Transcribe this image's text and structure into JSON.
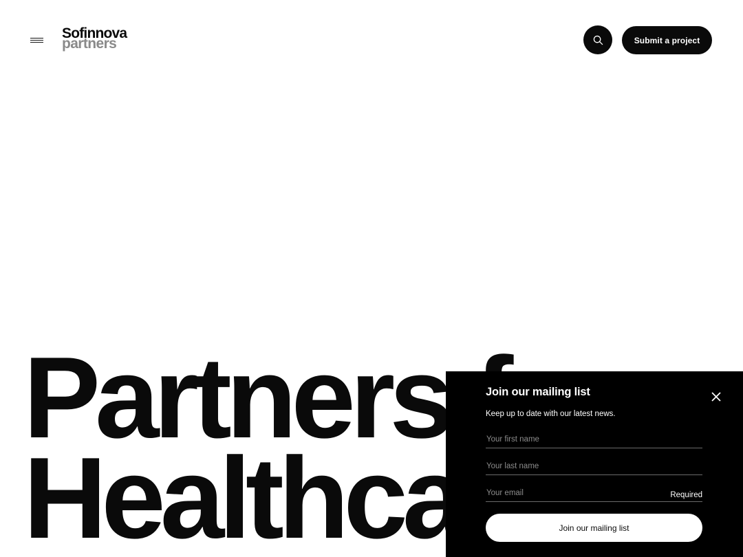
{
  "header": {
    "logo_top": "Sofinnova",
    "logo_bottom": "partners",
    "submit_label": "Submit a project"
  },
  "hero": {
    "line1": "Partners f",
    "line2": "Healthcare"
  },
  "popup": {
    "title": "Join our mailing list",
    "subtitle": "Keep up to date with our latest news.",
    "first_name_placeholder": "Your first name",
    "last_name_placeholder": "Your last name",
    "email_placeholder": "Your email",
    "required_label": "Required",
    "join_label": "Join our mailing list"
  },
  "icons": {
    "menu": "hamburger-icon",
    "search": "search-icon",
    "close": "close-icon"
  },
  "colors": {
    "primary": "#0a0a0a",
    "background": "#ffffff",
    "popup_bg": "#000000",
    "logo_secondary": "#8a8a8a"
  }
}
